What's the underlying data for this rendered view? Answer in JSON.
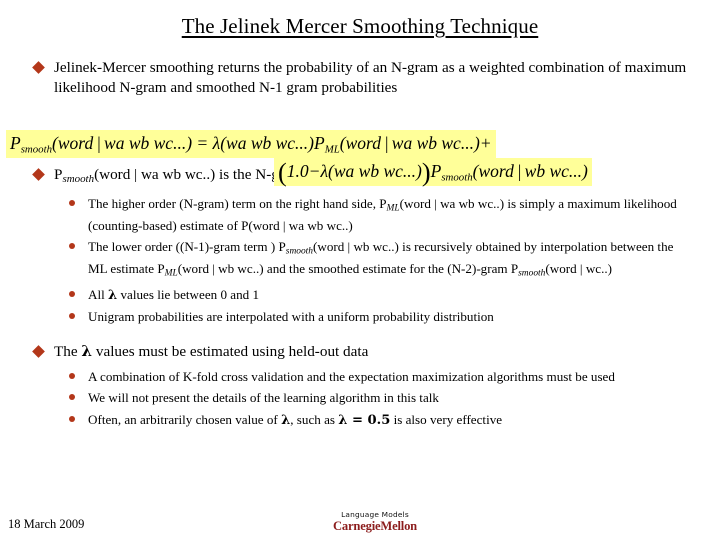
{
  "slide": {
    "title": "The Jelinek Mercer Smoothing Technique",
    "bullets": {
      "b1": "Jelinek-Mercer smoothing returns the probability of an N-gram as a weighted combination of maximum likelihood N-gram and smoothed N-1 gram probabilities",
      "b2_prefix": "P",
      "b2_sub": "smooth",
      "b2_rest": "(word | wa wb wc..) is the N-gram probability used during recognition",
      "b2_s1_a": "The higher order (N-gram) term on the right hand side, P",
      "b2_s1_sub": "ML",
      "b2_s1_b": "(word | wa wb wc..) is simply a maximum likelihood (counting-based) estimate of P(word | wa wb wc..)",
      "b2_s2_a": "The lower order ((N-1)-gram term ) P",
      "b2_s2_sub1": "smooth",
      "b2_s2_b": "(word | wb wc..) is recursively obtained by interpolation between the ML estimate P",
      "b2_s2_sub2": "ML",
      "b2_s2_c": "(word | wb wc..) and the smoothed estimate for the (N-2)-gram P",
      "b2_s2_sub3": "smooth",
      "b2_s2_d": "(word | wc..)",
      "b2_s3_a": "All ",
      "b2_s3_lambda": "λ",
      "b2_s3_b": " values lie between 0 and 1",
      "b2_s4": "Unigram probabilities are interpolated with a uniform probability distribution",
      "b3_a": "The ",
      "b3_lambda": "λ",
      "b3_b": " values must be estimated using held-out data",
      "b3_s1": "A combination of K-fold cross validation and the expectation maximization algorithms must be used",
      "b3_s2": "We will not present the details of the learning algorithm in this talk",
      "b3_s3_a": "Often, an arbitrarily chosen value of ",
      "b3_s3_lambda1": "λ",
      "b3_s3_b": ", such as ",
      "b3_s3_lambda2": "λ",
      "b3_s3_c": " = 0.5",
      "b3_s3_d": " is also very effective"
    },
    "formula": {
      "line1_p": "P",
      "line1_psub": "smooth",
      "line1_args": "(word",
      "line1_bar": "|",
      "line1_cond": "wa wb wc...)",
      "line1_eq": "=",
      "line1_lambda": "λ",
      "line1_lamargs": "(wa wb wc...)",
      "line1_pml": "P",
      "line1_pmlsub": "ML",
      "line1_pmlargs": "(word",
      "line1_pmlbar": "|",
      "line1_pmlcond": "wa wb wc...)",
      "line1_plus": "+",
      "line2_open": "(",
      "line2_one": "1.0",
      "line2_minus": "−",
      "line2_lambda": "λ",
      "line2_lamargs": "(wa wb wc...)",
      "line2_close": ")",
      "line2_p": "P",
      "line2_psub": "smooth",
      "line2_args": "(word",
      "line2_bar": "|",
      "line2_cond": "wb wc...)"
    },
    "footer": {
      "date": "18  March 2009",
      "logo_top": "Language Models",
      "logo_bottom": "CarnegieMellon"
    }
  }
}
